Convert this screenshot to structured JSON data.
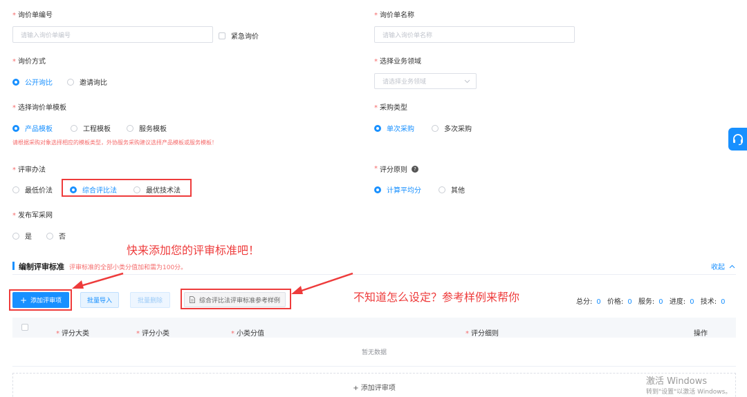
{
  "form": {
    "inquiry_no": {
      "label": "询价单编号",
      "placeholder": "请输入询价单编号"
    },
    "urgent": {
      "label": "紧急询价"
    },
    "inquiry_name": {
      "label": "询价单名称",
      "placeholder": "请输入询价单名称"
    },
    "inquiry_method": {
      "label": "询价方式",
      "options": [
        "公开询比",
        "邀请询比"
      ],
      "selected": "公开询比"
    },
    "business_field": {
      "label": "选择业务领域",
      "placeholder": "请选择业务领域"
    },
    "template": {
      "label": "选择询价单模板",
      "options": [
        "产品模板",
        "工程模板",
        "服务模板"
      ],
      "selected": "产品模板"
    },
    "template_hint": "请根据采购对象选择相应的模板类型，外协服务采购建议选择产品模板或服务模板！",
    "purchase_type": {
      "label": "采购类型",
      "options": [
        "单次采购",
        "多次采购"
      ],
      "selected": "单次采购"
    },
    "review_method": {
      "label": "评审办法",
      "options": [
        "最低价法",
        "综合评比法",
        "最优技术法"
      ],
      "selected": "综合评比法"
    },
    "scoring_principle": {
      "label": "评分原则",
      "options": [
        "计算平均分",
        "其他"
      ],
      "selected": "计算平均分"
    },
    "publish": {
      "label": "发布军采网",
      "options": [
        "是",
        "否"
      ]
    }
  },
  "section": {
    "title": "编制评审标准",
    "note": "评审标准的全部小类分值加和需为100分。",
    "collapse": "收起"
  },
  "toolbar": {
    "add": "添加评审项",
    "import": "批量导入",
    "delete": "批量删除",
    "example": "综合评比法评审标准参考样例"
  },
  "totals": {
    "total_label": "总分:",
    "total": "0",
    "price_label": "价格:",
    "price": "0",
    "service_label": "服务:",
    "service": "0",
    "progress_label": "进度:",
    "progress": "0",
    "tech_label": "技术:",
    "tech": "0"
  },
  "table": {
    "columns": [
      "评分大类",
      "评分小类",
      "小类分值",
      "评分细则",
      "操作"
    ],
    "empty": "暂无数据",
    "add_row": "+ 添加评审项"
  },
  "annotations": {
    "top": "快来添加您的评审标准吧！",
    "right": "不知道怎么设定？参考样例来帮你"
  },
  "watermark": {
    "line1": "激活 Windows",
    "line2": "转到\"设置\"以激活 Windows。"
  },
  "colors": {
    "primary": "#1890ff",
    "required": "#f56c6c",
    "annotation": "#ee3b3b"
  }
}
